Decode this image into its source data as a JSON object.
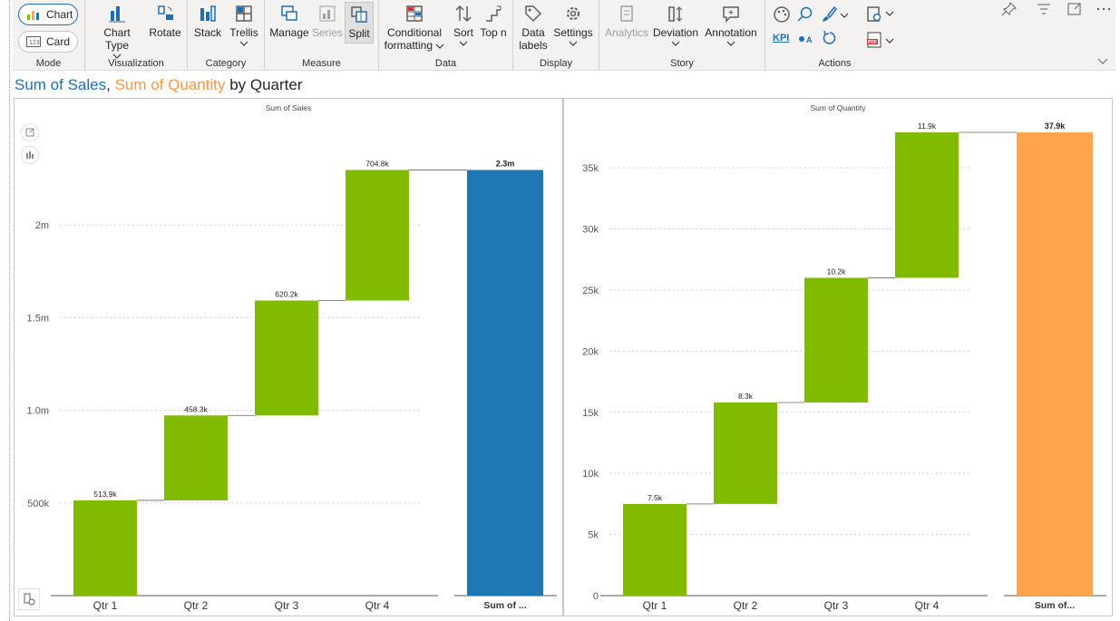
{
  "ribbon": {
    "mode": {
      "label": "Mode",
      "chart": "Chart",
      "card": "Card"
    },
    "visualization": {
      "label": "Visualization",
      "chart_type": "Chart Type",
      "rotate": "Rotate"
    },
    "category": {
      "label": "Category",
      "stack": "Stack",
      "trellis": "Trellis"
    },
    "measure": {
      "label": "Measure",
      "manage": "Manage",
      "series": "Series",
      "split": "Split"
    },
    "data": {
      "label": "Data",
      "conditional_line1": "Conditional",
      "conditional_line2": "formatting",
      "sort": "Sort",
      "topn": "Top n"
    },
    "display": {
      "label": "Display",
      "data_labels_line1": "Data",
      "data_labels_line2": "labels",
      "settings": "Settings"
    },
    "story": {
      "label": "Story",
      "analytics": "Analytics",
      "deviation": "Deviation",
      "annotation": "Annotation"
    },
    "actions": {
      "label": "Actions",
      "kpi": "KPI"
    }
  },
  "title": {
    "part1": "Sum of Sales",
    "sep": ",",
    "part2": "Sum of Quantity",
    "part3": "by Quarter"
  },
  "colors": {
    "sales": "#1f77b4",
    "quantity": "#ffa64d",
    "increase": "#80bb00",
    "accent": "#1f6fb2"
  },
  "chart_data": [
    {
      "type": "bar",
      "subtype": "waterfall",
      "title": "Sum of Sales",
      "categories": [
        "Qtr 1",
        "Qtr 2",
        "Qtr 3",
        "Qtr 4",
        "Sum of ..."
      ],
      "values": [
        513900,
        458300,
        620200,
        704800,
        2297200
      ],
      "data_labels": [
        "513.9k",
        "458.3k",
        "620.2k",
        "704.8k",
        "2.3m"
      ],
      "yticks": [
        500000,
        1000000,
        1500000,
        2000000
      ],
      "ytick_labels": [
        "500k",
        "1.0m",
        "1.5m",
        "2m"
      ],
      "ylim": [
        0,
        2500000
      ],
      "total_color": "#1f77b4"
    },
    {
      "type": "bar",
      "subtype": "waterfall",
      "title": "Sum of Quantity",
      "categories": [
        "Qtr 1",
        "Qtr 2",
        "Qtr 3",
        "Qtr 4",
        "Sum of..."
      ],
      "values": [
        7500,
        8300,
        10200,
        11900,
        37900
      ],
      "data_labels": [
        "7.5k",
        "8.3k",
        "10.2k",
        "11.9k",
        "37.9k"
      ],
      "yticks": [
        0,
        5000,
        10000,
        15000,
        20000,
        25000,
        30000,
        35000
      ],
      "ytick_labels": [
        "0",
        "5k",
        "10k",
        "15k",
        "20k",
        "25k",
        "30k",
        "35k"
      ],
      "ylim": [
        0,
        37900
      ],
      "total_color": "#ffa64d"
    }
  ]
}
